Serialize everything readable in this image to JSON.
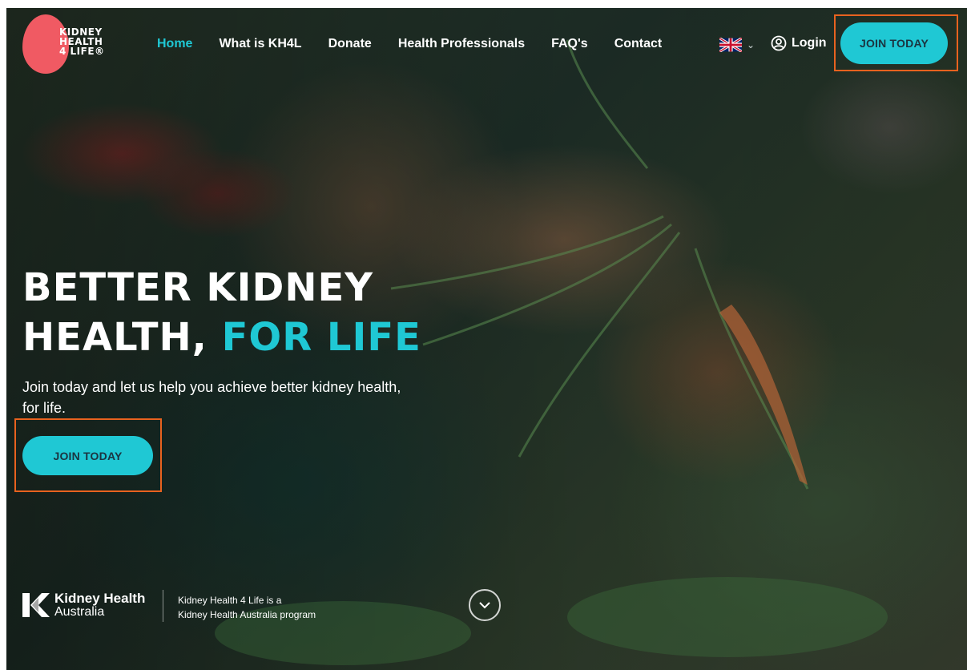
{
  "brand": {
    "logo_lines": [
      "KIDNEY",
      "HEALTH",
      "4 LIFE®"
    ],
    "accent": "#1fc8d4",
    "logo_color": "#f05a63"
  },
  "nav": {
    "items": [
      {
        "label": "Home",
        "active": true
      },
      {
        "label": "What is KH4L"
      },
      {
        "label": "Donate"
      },
      {
        "label": "Health Professionals"
      },
      {
        "label": "FAQ's"
      },
      {
        "label": "Contact"
      }
    ],
    "language_icon": "uk-flag-icon",
    "login_label": "Login",
    "join_label": "JOIN TODAY"
  },
  "hero": {
    "headline_line1": "BETTER KIDNEY",
    "headline_line2_white": "HEALTH, ",
    "headline_line2_accent": "FOR LIFE",
    "subtext": "Join today and let us help you achieve better kidney health, for life.",
    "cta_label": "JOIN TODAY"
  },
  "footer": {
    "kha_name": "Kidney Health",
    "kha_sub": "Australia",
    "program_line1": "Kidney Health 4 Life is a",
    "program_line2": "Kidney Health Australia program"
  },
  "highlight_color": "#e8621f"
}
